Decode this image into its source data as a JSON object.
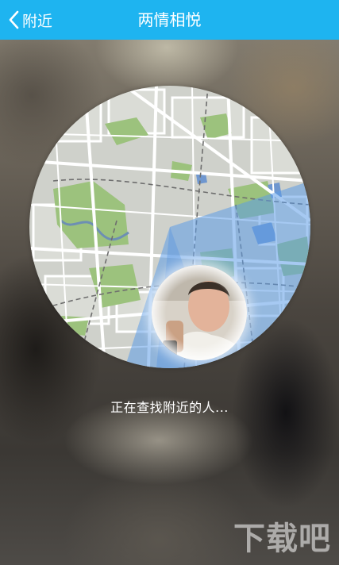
{
  "header": {
    "back_label": "附近",
    "title": "两情相悦"
  },
  "icons": {
    "back": "chevron-left-icon"
  },
  "status": {
    "text": "正在查找附近的人..."
  },
  "watermark": {
    "text": "下载吧"
  },
  "colors": {
    "header_bg": "#1eb4f0",
    "header_text": "#ffffff",
    "map_base": "#cfd1cb",
    "map_park": "#9cc27d",
    "map_water": "#8fb4e4",
    "radar_sweep": "#5d9ce8"
  }
}
